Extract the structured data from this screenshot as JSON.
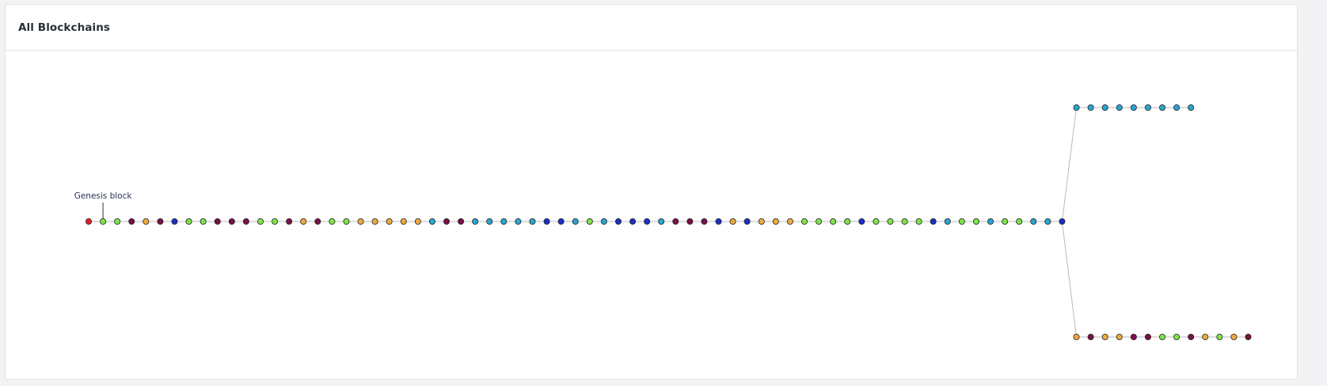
{
  "card": {
    "title": "All Blockchains"
  },
  "diagram": {
    "genesis_label": "Genesis block",
    "palette": {
      "red": "#e0202a",
      "green": "#7ee34a",
      "purple": "#7a1045",
      "orange": "#eeaa3e",
      "blue": "#1a2fc8",
      "cyan": "#2aa5d2"
    },
    "node_stroke": "#222222",
    "edge_color": "#b8b8b8",
    "genesis_index": 1,
    "main_chain": [
      "red",
      "green",
      "green",
      "purple",
      "orange",
      "purple",
      "blue",
      "green",
      "green",
      "purple",
      "purple",
      "purple",
      "green",
      "green",
      "purple",
      "orange",
      "purple",
      "green",
      "green",
      "orange",
      "orange",
      "orange",
      "orange",
      "orange",
      "cyan",
      "purple",
      "purple",
      "cyan",
      "cyan",
      "cyan",
      "cyan",
      "cyan",
      "blue",
      "blue",
      "cyan",
      "green",
      "cyan",
      "blue",
      "blue",
      "blue",
      "cyan",
      "purple",
      "purple",
      "purple",
      "blue",
      "orange",
      "blue",
      "orange",
      "orange",
      "orange",
      "green",
      "green",
      "green",
      "green",
      "blue",
      "green",
      "green",
      "green",
      "green",
      "blue",
      "cyan",
      "green",
      "green",
      "cyan",
      "green",
      "green",
      "cyan",
      "cyan",
      "blue"
    ],
    "upper_fork": [
      "cyan",
      "cyan",
      "cyan",
      "cyan",
      "cyan",
      "cyan",
      "cyan",
      "cyan",
      "cyan"
    ],
    "lower_fork": [
      "orange",
      "purple",
      "orange",
      "orange",
      "purple",
      "purple",
      "green",
      "green",
      "purple",
      "orange",
      "green",
      "orange",
      "purple"
    ]
  }
}
